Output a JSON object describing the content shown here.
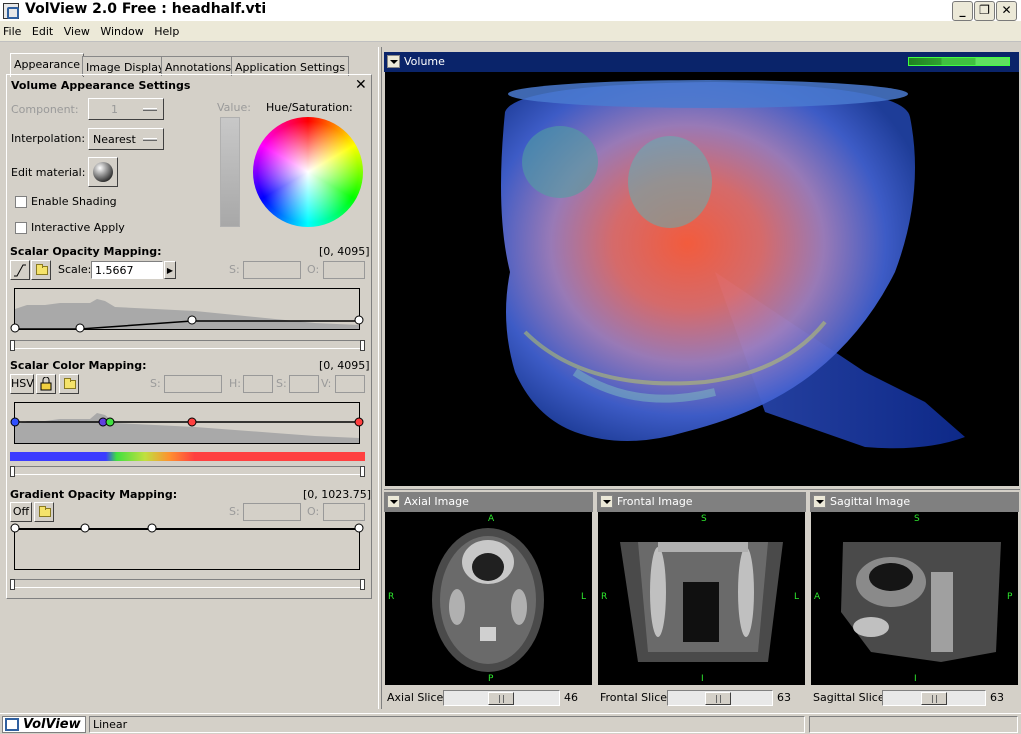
{
  "window": {
    "title": "VolView 2.0 Free : headhalf.vti"
  },
  "menu": [
    "File",
    "Edit",
    "View",
    "Window",
    "Help"
  ],
  "tabs": [
    "Appearance",
    "Image Display",
    "Annotations",
    "Application Settings"
  ],
  "appearance": {
    "section_title": "Volume Appearance Settings",
    "component_label": "Component:",
    "component_value": "1",
    "interpolation_label": "Interpolation:",
    "interpolation_value": "Nearest",
    "edit_material_label": "Edit material:",
    "enable_shading_label": "Enable Shading",
    "interactive_apply_label": "Interactive Apply",
    "value_label": "Value:",
    "hue_sat_label": "Hue/Saturation:"
  },
  "opacity": {
    "title": "Scalar Opacity Mapping:",
    "range": "[0, 4095]",
    "scale_label": "Scale:",
    "scale_value": "1.5667",
    "s_label": "S:",
    "o_label": "O:"
  },
  "color_map": {
    "title": "Scalar Color Mapping:",
    "range": "[0, 4095]",
    "mode_button": "HSV",
    "s_label": "S:",
    "h_label": "H:",
    "s2_label": "S:",
    "v_label": "V:"
  },
  "gradient": {
    "title": "Gradient Opacity Mapping:",
    "range": "[0, 1023.75]",
    "off_button": "Off",
    "s_label": "S:",
    "o_label": "O:"
  },
  "views": {
    "volume": {
      "title": "Volume"
    },
    "axial": {
      "title": "Axial Image",
      "slice_label": "Axial Slice:",
      "slice_value": "46",
      "top": "A",
      "bottom": "P",
      "left": "R",
      "right": "L"
    },
    "frontal": {
      "title": "Frontal Image",
      "slice_label": "Frontal Slice:",
      "slice_value": "63",
      "top": "S",
      "bottom": "I",
      "left": "R",
      "right": "L"
    },
    "sagittal": {
      "title": "Sagittal Image",
      "slice_label": "Sagittal Slice:",
      "slice_value": "63",
      "top": "S",
      "bottom": "I",
      "left": "A",
      "right": "P"
    }
  },
  "status": {
    "logo": "VolView",
    "mode": "Linear"
  },
  "colors": {
    "view_header": "#0a246a",
    "orientation_label": "#2ee82e",
    "titlebar_bg": "#ffffff"
  }
}
